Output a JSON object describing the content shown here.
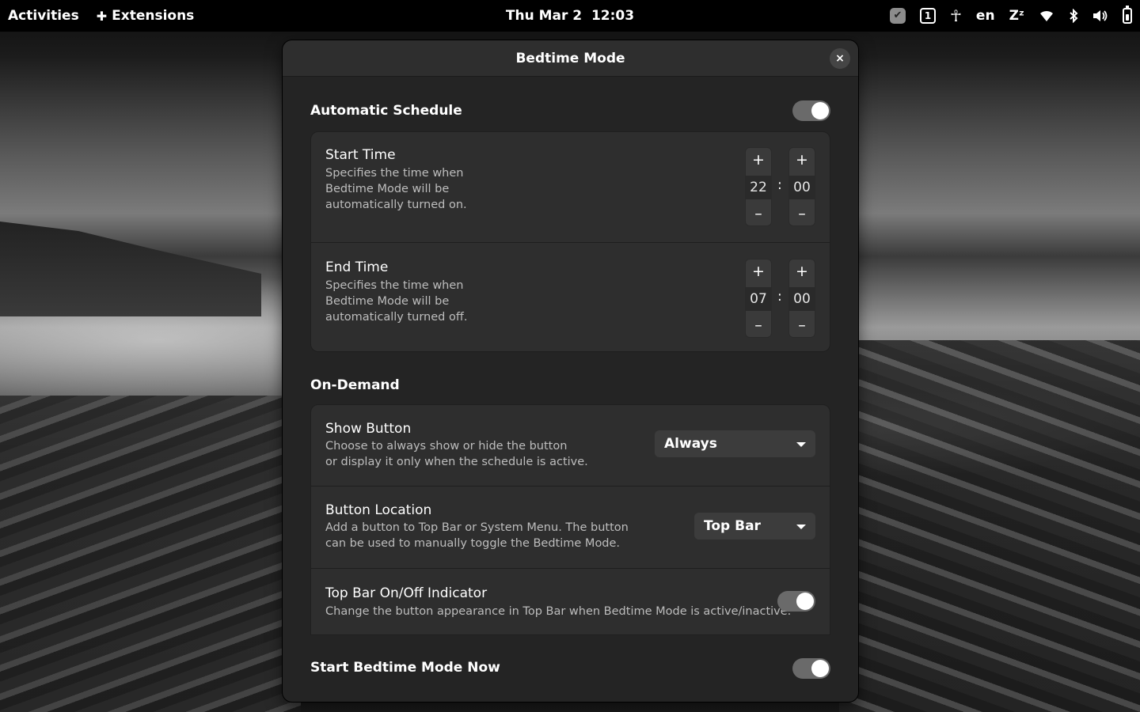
{
  "topbar": {
    "activities": "Activities",
    "extensions": "Extensions",
    "clock": "Thu Mar 2  12:03",
    "workspace": "1",
    "language": "en",
    "sleep": "Zᶻ"
  },
  "dialog": {
    "title": "Bedtime Mode",
    "close": "×",
    "schedule": {
      "heading": "Automatic Schedule",
      "enabled": true,
      "start": {
        "title": "Start Time",
        "subtitle": "Specifies the time when\nBedtime Mode will be\nautomatically turned on.",
        "hour": "22",
        "minute": "00"
      },
      "end": {
        "title": "End Time",
        "subtitle": "Specifies the time when\nBedtime Mode will be\nautomatically turned off.",
        "hour": "07",
        "minute": "00"
      },
      "separator": ":"
    },
    "ondemand": {
      "heading": "On-Demand",
      "show_button": {
        "title": "Show Button",
        "subtitle": "Choose to always show or hide the button\nor display it only when the schedule is active.",
        "value": "Always"
      },
      "button_location": {
        "title": "Button Location",
        "subtitle": "Add a button to Top Bar or System Menu. The button\ncan be used to manually toggle the Bedtime Mode.",
        "value": "Top Bar"
      },
      "indicator": {
        "title": "Top Bar On/Off Indicator",
        "subtitle": "Change the button appearance in Top Bar when Bedtime Mode is active/inactive.",
        "enabled": true
      }
    },
    "start_now": {
      "label": "Start Bedtime Mode Now",
      "enabled": true
    }
  },
  "colors": {
    "dialog_bg": "#242424",
    "card_bg": "#2e2e2e",
    "switch_track": "#6a6a6a",
    "topbar_bg": "#000000"
  }
}
